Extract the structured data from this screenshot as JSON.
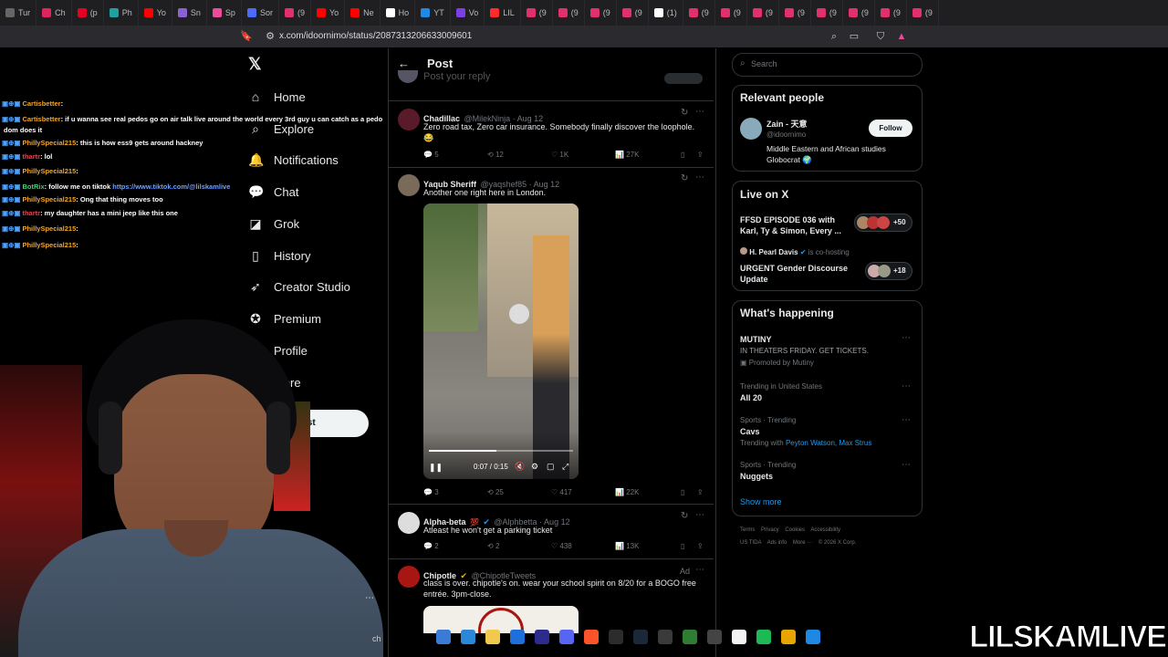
{
  "browser": {
    "tabs": [
      {
        "label": "Tur",
        "color": "#666"
      },
      {
        "label": "Ch",
        "color": "#e0245e"
      },
      {
        "label": "(p",
        "color": "#e60023"
      },
      {
        "label": "Ph",
        "color": "#1da1a1"
      },
      {
        "label": "Yo",
        "color": "#ff0000"
      },
      {
        "label": "Sn",
        "color": "#8a63d2"
      },
      {
        "label": "Sp",
        "color": "#e94d9a"
      },
      {
        "label": "Sor",
        "color": "#4a6cf7"
      },
      {
        "label": "(9",
        "color": "#e1306c"
      },
      {
        "label": "Yo",
        "color": "#ff0000"
      },
      {
        "label": "Ne",
        "color": "#ff0000"
      },
      {
        "label": "Ho",
        "color": "#fff"
      },
      {
        "label": "YT",
        "color": "#1e88e5"
      },
      {
        "label": "Vo",
        "color": "#7b3fe4"
      },
      {
        "label": "LIL",
        "color": "#ff2a2a"
      },
      {
        "label": "(9",
        "color": "#e1306c"
      },
      {
        "label": "(9",
        "color": "#e1306c"
      },
      {
        "label": "(9",
        "color": "#e1306c"
      },
      {
        "label": "(9",
        "color": "#e1306c"
      },
      {
        "label": "(1)",
        "color": "#fff"
      },
      {
        "label": "(9",
        "color": "#e1306c"
      },
      {
        "label": "(9",
        "color": "#e1306c"
      },
      {
        "label": "(9",
        "color": "#e1306c"
      },
      {
        "label": "(9",
        "color": "#e1306c"
      },
      {
        "label": "(9",
        "color": "#e1306c"
      },
      {
        "label": "(9",
        "color": "#e1306c"
      },
      {
        "label": "(9",
        "color": "#e1306c"
      },
      {
        "label": "(9",
        "color": "#e1306c"
      }
    ],
    "url": "x.com/idoornimo/status/2087313206633009601"
  },
  "nav": {
    "home": "Home",
    "explore": "Explore",
    "notifications": "Notifications",
    "chat": "Chat",
    "grok": "Grok",
    "history": "History",
    "creator_studio": "Creator Studio",
    "premium": "Premium",
    "profile": "Profile",
    "more": "More",
    "post_button": "Post"
  },
  "chat": [
    {
      "user": "Cartisbetter",
      "color": "orange",
      "msg": ": "
    },
    {
      "user": "Cartisbetter",
      "color": "orange",
      "msg": ": if u wanna see real pedos go on air talk live around the world every 3rd guy u can catch as a pedo"
    },
    {
      "user": "",
      "color": "orange",
      "msg": "dom does it"
    },
    {
      "user": "PhillySpecial215",
      "color": "orange",
      "msg": ": this is how ess9 gets around hackney"
    },
    {
      "user": "thartr",
      "color": "red",
      "msg": ": lol"
    },
    {
      "user": "PhillySpecial215",
      "color": "orange",
      "msg": ": "
    },
    {
      "user": "BotRix",
      "color": "green",
      "msg": ": follow me on tiktok ",
      "link": "https://www.tiktok.com/@lilskamlive"
    },
    {
      "user": "PhillySpecial215",
      "color": "orange",
      "msg": ": Ong that thing moves too"
    },
    {
      "user": "thartr",
      "color": "red",
      "msg": ": my daughter has a mini jeep like this one"
    },
    {
      "user": "PhillySpecial215",
      "color": "orange",
      "msg": ": "
    },
    {
      "user": "PhillySpecial215",
      "color": "orange",
      "msg": ": "
    }
  ],
  "post_header": {
    "title": "Post",
    "reply_placeholder": "Post your reply"
  },
  "tweets": [
    {
      "name": "Chadillac",
      "handle": "@MilekNinja · Aug 12",
      "text": "Zero road tax, Zero car insurance. Somebody finally discover the loophole.",
      "text2": "😂",
      "replies": "5",
      "reposts": "12",
      "likes": "1K",
      "views": "27K"
    },
    {
      "name": "Yaqub Sheriff",
      "handle": "@yaqshef85 · Aug 12",
      "text": "Another one right here in London.",
      "replies": "3",
      "reposts": "25",
      "likes": "417",
      "views": "22K",
      "video_time": "0:07 / 0:15",
      "video_progress": 0.47
    },
    {
      "name": "Alpha-beta",
      "handle": "@Alphbetta · Aug 12",
      "text": "Atleast he won't get a parking ticket",
      "replies": "2",
      "reposts": "2",
      "likes": "438",
      "views": "13K"
    },
    {
      "name": "Chipotle",
      "handle": "@ChipotleTweets",
      "ad": "Ad",
      "text": "class is over. chipotle's on. wear your school spirit on 8/20 for a BOGO free",
      "text2": "entrée. 3pm-close."
    }
  ],
  "search": {
    "placeholder": "Search"
  },
  "relevant": {
    "title": "Relevant people",
    "name": "Zain - 天意",
    "handle": "@idoornimo",
    "follow": "Follow",
    "bio": "Middle Eastern and African studies",
    "bio2": "Globocrat 🌍"
  },
  "live": {
    "title": "Live on X",
    "items": [
      {
        "title": "FFSD EPISODE 036 with",
        "title2": "Karl, Ty & Simon, Every ...",
        "count": "+50"
      },
      {
        "host": "H. Pearl Davis",
        "hosting": "is co-hosting",
        "title": "URGENT Gender Discourse",
        "title2": "Update",
        "count": "+18"
      }
    ]
  },
  "happening": {
    "title": "What's happening",
    "items": [
      {
        "top": "",
        "name": "MUTINY",
        "sub": "IN THEATERS FRIDAY. GET TICKETS.",
        "promo": "Promoted by Mutiny"
      },
      {
        "top": "Trending in United States",
        "name": "All 20",
        "sub": ""
      },
      {
        "top": "Sports · Trending",
        "name": "Cavs",
        "sub": "Trending with ",
        "links": "Peyton Watson, Max Strus"
      },
      {
        "top": "Sports · Trending",
        "name": "Nuggets",
        "sub": ""
      }
    ],
    "show_more": "Show more"
  },
  "footer": {
    "line1": "Terms    Privacy    Cookies    Accessibility",
    "line2": "US TIDA    Ads info    More ···    © 2026 X Corp."
  },
  "taskbar": {
    "search_fragment": "ch"
  },
  "watermark": "LILSKAMLIVE",
  "colors": {
    "accent": "#1d9bf0",
    "bg": "#000000",
    "border": "#2f3336",
    "muted": "#71767b"
  }
}
